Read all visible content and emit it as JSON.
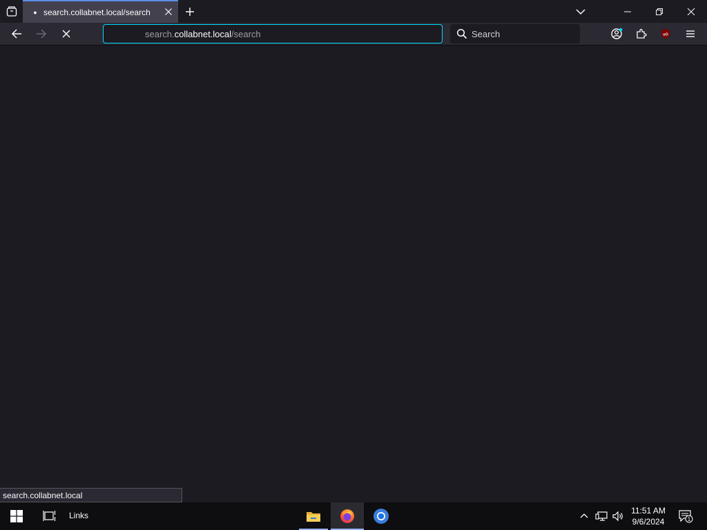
{
  "tab": {
    "title": "search.collabnet.local/search",
    "favicon": "dot-icon"
  },
  "urlbar": {
    "prefix": "search.",
    "host": "collabnet.local",
    "suffix": "/search"
  },
  "searchbar": {
    "placeholder": "Search"
  },
  "status": {
    "text": "search.collabnet.local"
  },
  "taskbar": {
    "links_label": "Links",
    "time": "11:51 AM",
    "date": "9/6/2024",
    "notification_count": "1"
  },
  "colors": {
    "accent": "#00ddff",
    "tab_border": "#5b8ee8",
    "background": "#1c1b22",
    "ublock": "#800000"
  }
}
